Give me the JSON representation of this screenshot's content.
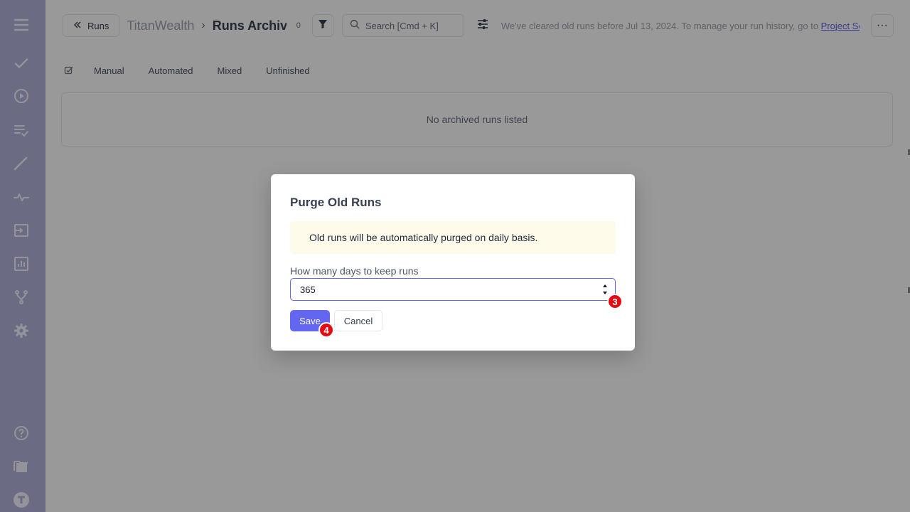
{
  "sidebar": {
    "icons": [
      "menu-icon",
      "check-icon",
      "play-icon",
      "checklist-icon",
      "steps-icon",
      "pulse-icon",
      "import-icon",
      "analytics-icon",
      "branch-icon",
      "gear-icon",
      "help-icon",
      "folder-icon",
      "account-icon"
    ]
  },
  "header": {
    "back_label": "Runs",
    "project": "TitanWealth",
    "separator": "›",
    "page_title": "Runs Archive",
    "count": "0",
    "search_placeholder": "Search [Cmd + K]",
    "notice_text": "We've cleared old runs before Jul 13, 2024. To manage your run history, go to ",
    "notice_link": "Project Se...",
    "more_label": "···"
  },
  "filters": {
    "tabs": [
      "Manual",
      "Automated",
      "Mixed",
      "Unfinished"
    ]
  },
  "empty_state": "No archived runs listed",
  "modal": {
    "title": "Purge Old Runs",
    "alert": "Old runs will be automatically purged on daily basis.",
    "field_label": "How many days to keep runs",
    "field_value": "365",
    "save_label": "Save",
    "cancel_label": "Cancel"
  },
  "annotations": {
    "badge_input": "3",
    "badge_save": "4"
  },
  "colors": {
    "accent": "#6366f1",
    "sidebar": "#b3b3dc",
    "badge": "#e50914",
    "alert_bg": "#fefbeb"
  }
}
